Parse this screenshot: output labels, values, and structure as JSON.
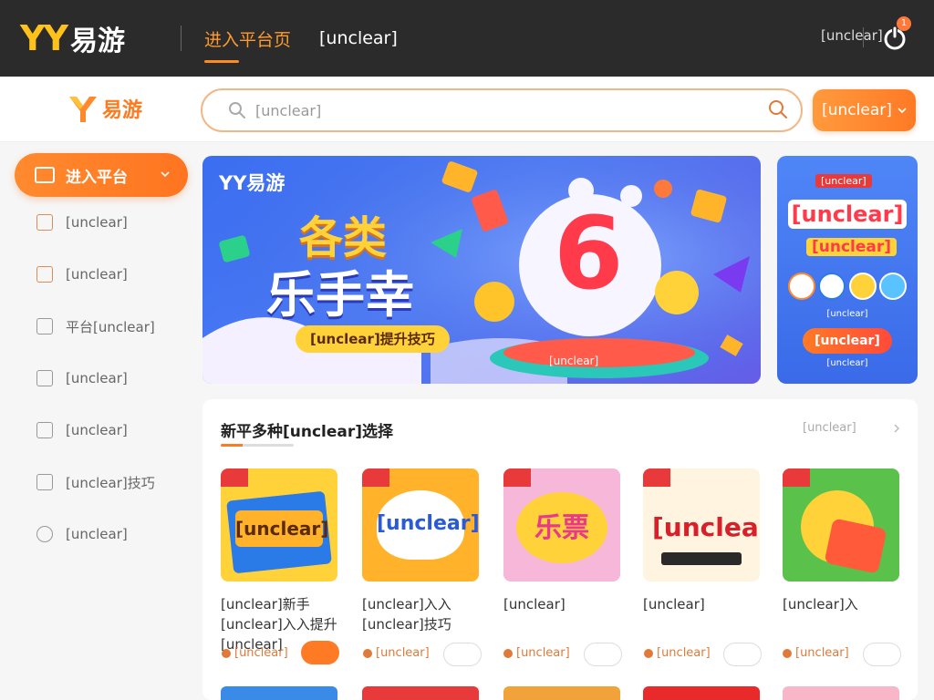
{
  "topbar": {
    "logo_yy": "YY",
    "logo_text": "易游",
    "nav": [
      "进入平台页",
      "[unclear]"
    ],
    "right_label": "[unclear]",
    "notification_count": "1"
  },
  "header": {
    "logo_text": "易游",
    "search_placeholder": "[unclear]",
    "button_label": "[unclear]"
  },
  "sidebar": {
    "active": "进入平台",
    "items": [
      "[unclear]",
      "[unclear]",
      "平台[unclear]",
      "[unclear]",
      "[unclear]",
      "[unclear]技巧",
      "[unclear]"
    ]
  },
  "banner": {
    "brand": "YY易游",
    "headline1": "各类",
    "headline2": "乐手幸",
    "pill": "[unclear]提升技巧",
    "big_number": "6",
    "bottom_label": "[unclear]"
  },
  "side_banner": {
    "tag": "[unclear]",
    "headline": "[unclear]",
    "sub": "[unclear]",
    "caption": "[unclear]",
    "button": "[unclear]",
    "footer": "[unclear]"
  },
  "section": {
    "title": "新平多种[unclear]选择",
    "more": "[unclear]"
  },
  "cards": [
    {
      "img_text": "[unclear]",
      "title": "[unclear]新手[unclear]入入提升[unclear]",
      "count": "[unclear]",
      "colors": [
        "#ffd23a",
        "#2a7ae8"
      ]
    },
    {
      "img_text": "[unclear]",
      "title": "[unclear]入入[unclear]技巧",
      "count": "[unclear]",
      "colors": [
        "#ffb22a",
        "#2a5ad8"
      ]
    },
    {
      "img_text": "乐票",
      "title": "[unclear]",
      "count": "[unclear]",
      "colors": [
        "#f7b7d8",
        "#e83a8a"
      ]
    },
    {
      "img_text": "[unclear]",
      "title": "[unclear]",
      "count": "[unclear]",
      "colors": [
        "#fff4e0",
        "#d8202a"
      ]
    },
    {
      "img_text": "",
      "title": "[unclear]入",
      "count": "[unclear]",
      "colors": [
        "#5ac24a",
        "#ff5a3a"
      ]
    }
  ],
  "colors": {
    "accent": "#ff7a25",
    "topbar": "#2b2b2b",
    "banner": "#3a6df0"
  }
}
